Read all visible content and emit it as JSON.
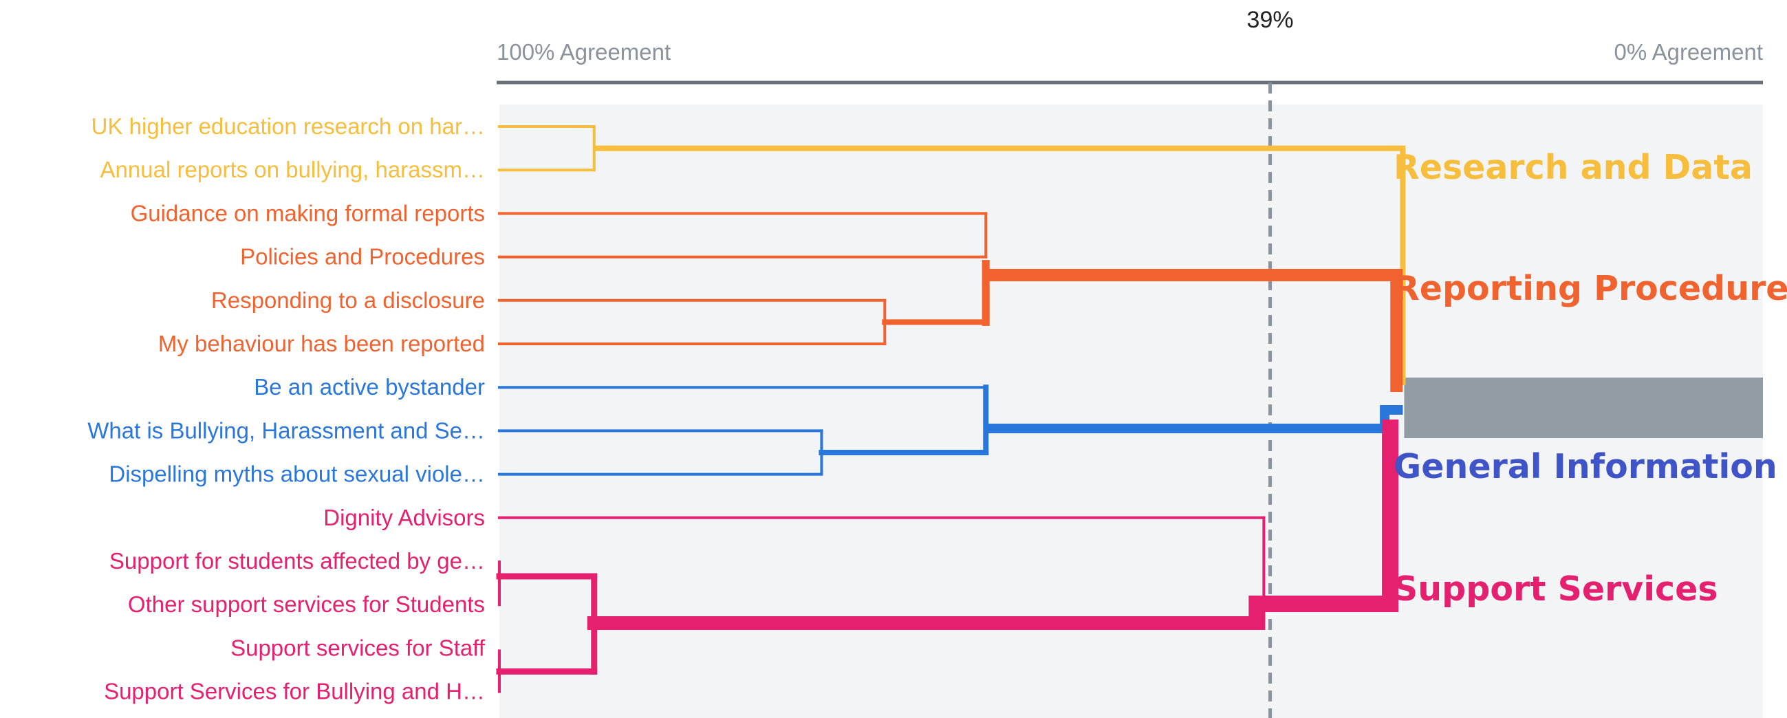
{
  "chart_data": {
    "type": "dendrogram",
    "axis": {
      "left_label": "100% Agreement",
      "right_label": "0% Agreement",
      "range": [
        100,
        0
      ]
    },
    "cut_line": {
      "value": 39,
      "label": "39%"
    },
    "colors": {
      "research": "#f7bd3c",
      "reporting": "#f0632f",
      "general": "#2a77dc",
      "support": "#e5206f",
      "general_label": "#3f55c7",
      "neutral_band": "#929ca4",
      "plot_bg": "#f3f4f6",
      "axis_line": "#6b7179",
      "cut_line": "#8a929b"
    },
    "leaves": [
      {
        "label": "UK higher education research on har…",
        "group": "research"
      },
      {
        "label": "Annual reports on bullying, harassm…",
        "group": "research"
      },
      {
        "label": "Guidance on making formal reports",
        "group": "reporting"
      },
      {
        "label": "Policies and Procedures",
        "group": "reporting"
      },
      {
        "label": "Responding to a disclosure",
        "group": "reporting"
      },
      {
        "label": "My behaviour has been reported",
        "group": "reporting"
      },
      {
        "label": "Be an active bystander",
        "group": "general"
      },
      {
        "label": "What is Bullying, Harassment and Se…",
        "group": "general"
      },
      {
        "label": "Dispelling myths about sexual viole…",
        "group": "general"
      },
      {
        "label": "Dignity Advisors",
        "group": "support"
      },
      {
        "label": "Support for students affected by ge…",
        "group": "support"
      },
      {
        "label": "Other support services for Students",
        "group": "support"
      },
      {
        "label": "Support services for Staff",
        "group": "support"
      },
      {
        "label": "Support Services for Bullying and H…",
        "group": "support"
      }
    ],
    "clusters": [
      {
        "label": "Research and Data",
        "group": "research"
      },
      {
        "label": "Reporting Procedure",
        "group": "reporting"
      },
      {
        "label": "General Information",
        "group": "general"
      },
      {
        "label": "Support Services",
        "group": "support"
      }
    ],
    "merges": [
      {
        "group": "research",
        "children": [
          0,
          1
        ],
        "agreement": 92.5,
        "thick": 4
      },
      {
        "group": "research",
        "children": [
          "research-92.5",
          "root"
        ],
        "agreement": 28.5,
        "thick": 8
      },
      {
        "group": "reporting",
        "children": [
          4,
          5
        ],
        "agreement": 69.5,
        "thick": 4
      },
      {
        "group": "reporting",
        "children": [
          2,
          3
        ],
        "agreement": 61.5,
        "thick": 4
      },
      {
        "group": "reporting",
        "children": [
          "pair-2-3",
          "pair-4-5"
        ],
        "agreement": 61.5,
        "thick": 11
      },
      {
        "group": "reporting",
        "children": [
          "reporting",
          "root"
        ],
        "agreement": 29.0,
        "thick": 18
      },
      {
        "group": "general",
        "children": [
          7,
          8
        ],
        "agreement": 74.5,
        "thick": 4
      },
      {
        "group": "general",
        "children": [
          6,
          "pair-7-8"
        ],
        "agreement": 61.5,
        "thick": 11
      },
      {
        "group": "general",
        "children": [
          "general",
          "root"
        ],
        "agreement": 29.5,
        "thick": 14
      },
      {
        "group": "support",
        "children": [
          10,
          11
        ],
        "agreement": 92.5,
        "thick": 9
      },
      {
        "group": "support",
        "children": [
          12,
          13
        ],
        "agreement": 92.5,
        "thick": 9
      },
      {
        "group": "support",
        "children": [
          "pair-10-11",
          "pair-12-13"
        ],
        "agreement": 92.5,
        "thick": 9
      },
      {
        "group": "support",
        "children": [
          9,
          "pair-10-13"
        ],
        "agreement": 39.5,
        "thick": 20
      },
      {
        "group": "support",
        "children": [
          "support",
          "root"
        ],
        "agreement": 29.5,
        "thick": 24
      }
    ]
  }
}
